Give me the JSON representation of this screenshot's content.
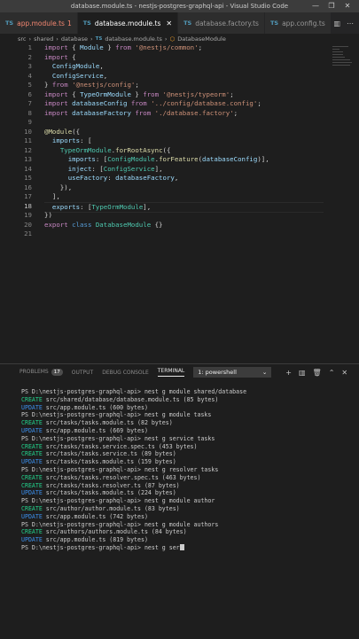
{
  "window": {
    "title": "database.module.ts - nestjs-postgres-graphql-api - Visual Studio Code",
    "controls": [
      "—",
      "❐",
      "✕"
    ]
  },
  "tabs": [
    {
      "label": "app.module.ts",
      "badge": "1",
      "state": "error"
    },
    {
      "label": "database.module.ts",
      "badge": "",
      "state": "active"
    },
    {
      "label": "database.factory.ts",
      "badge": "",
      "state": "normal"
    },
    {
      "label": "app.config.ts",
      "badge": "",
      "state": "normal"
    }
  ],
  "breadcrumb": {
    "parts": [
      "src",
      "shared",
      "database"
    ],
    "file": "database.module.ts",
    "symbol": "DatabaseModule"
  },
  "editor": {
    "current_line": 18,
    "lines": [
      {
        "n": "1",
        "t": [
          [
            "k",
            "import"
          ],
          [
            "p",
            " { "
          ],
          [
            "v",
            "Module"
          ],
          [
            "p",
            " } "
          ],
          [
            "k",
            "from"
          ],
          [
            "p",
            " "
          ],
          [
            "s",
            "'@nestjs/common'"
          ],
          [
            "p",
            ";"
          ]
        ]
      },
      {
        "n": "2",
        "t": [
          [
            "k",
            "import"
          ],
          [
            "p",
            " {"
          ]
        ]
      },
      {
        "n": "3",
        "t": [
          [
            "p",
            "  "
          ],
          [
            "v",
            "ConfigModule"
          ],
          [
            "p",
            ","
          ]
        ]
      },
      {
        "n": "4",
        "t": [
          [
            "p",
            "  "
          ],
          [
            "v",
            "ConfigService"
          ],
          [
            "p",
            ","
          ]
        ]
      },
      {
        "n": "5",
        "t": [
          [
            "p",
            "} "
          ],
          [
            "k",
            "from"
          ],
          [
            "p",
            " "
          ],
          [
            "s",
            "'@nestjs/config'"
          ],
          [
            "p",
            ";"
          ]
        ]
      },
      {
        "n": "6",
        "t": [
          [
            "k",
            "import"
          ],
          [
            "p",
            " { "
          ],
          [
            "v",
            "TypeOrmModule"
          ],
          [
            "p",
            " } "
          ],
          [
            "k",
            "from"
          ],
          [
            "p",
            " "
          ],
          [
            "s",
            "'@nestjs/typeorm'"
          ],
          [
            "p",
            ";"
          ]
        ]
      },
      {
        "n": "7",
        "t": [
          [
            "k",
            "import"
          ],
          [
            "p",
            " "
          ],
          [
            "v",
            "databaseConfig"
          ],
          [
            "p",
            " "
          ],
          [
            "k",
            "from"
          ],
          [
            "p",
            " "
          ],
          [
            "s",
            "'../config/database.config'"
          ],
          [
            "p",
            ";"
          ]
        ]
      },
      {
        "n": "8",
        "t": [
          [
            "k",
            "import"
          ],
          [
            "p",
            " "
          ],
          [
            "v",
            "databaseFactory"
          ],
          [
            "p",
            " "
          ],
          [
            "k",
            "from"
          ],
          [
            "p",
            " "
          ],
          [
            "s",
            "'./database.factory'"
          ],
          [
            "p",
            ";"
          ]
        ]
      },
      {
        "n": "9",
        "t": []
      },
      {
        "n": "10",
        "t": [
          [
            "d",
            "@"
          ],
          [
            "f",
            "Module"
          ],
          [
            "p",
            "({"
          ]
        ]
      },
      {
        "n": "11",
        "t": [
          [
            "p",
            "  "
          ],
          [
            "v",
            "imports"
          ],
          [
            "p",
            ": ["
          ]
        ]
      },
      {
        "n": "12",
        "t": [
          [
            "p",
            "    "
          ],
          [
            "c",
            "TypeOrmModule"
          ],
          [
            "p",
            "."
          ],
          [
            "f",
            "forRootAsync"
          ],
          [
            "p",
            "({"
          ]
        ]
      },
      {
        "n": "13",
        "t": [
          [
            "p",
            "      "
          ],
          [
            "v",
            "imports"
          ],
          [
            "p",
            ": ["
          ],
          [
            "c",
            "ConfigModule"
          ],
          [
            "p",
            "."
          ],
          [
            "f",
            "forFeature"
          ],
          [
            "p",
            "("
          ],
          [
            "v",
            "databaseConfig"
          ],
          [
            "p",
            ")],"
          ]
        ]
      },
      {
        "n": "14",
        "t": [
          [
            "p",
            "      "
          ],
          [
            "v",
            "inject"
          ],
          [
            "p",
            ": ["
          ],
          [
            "c",
            "ConfigService"
          ],
          [
            "p",
            "],"
          ]
        ]
      },
      {
        "n": "15",
        "t": [
          [
            "p",
            "      "
          ],
          [
            "v",
            "useFactory"
          ],
          [
            "p",
            ": "
          ],
          [
            "v",
            "databaseFactory"
          ],
          [
            "p",
            ","
          ]
        ]
      },
      {
        "n": "16",
        "t": [
          [
            "p",
            "    }),"
          ]
        ]
      },
      {
        "n": "17",
        "t": [
          [
            "p",
            "  ],"
          ]
        ]
      },
      {
        "n": "18",
        "t": [
          [
            "p",
            "  "
          ],
          [
            "v",
            "exports"
          ],
          [
            "p",
            ": ["
          ],
          [
            "c",
            "TypeOrmModule"
          ],
          [
            "p",
            "],"
          ]
        ]
      },
      {
        "n": "19",
        "t": [
          [
            "p",
            "})"
          ]
        ]
      },
      {
        "n": "20",
        "t": [
          [
            "k",
            "export"
          ],
          [
            "p",
            " "
          ],
          [
            "kb",
            "class"
          ],
          [
            "p",
            " "
          ],
          [
            "c",
            "DatabaseModule"
          ],
          [
            "p",
            " {}"
          ]
        ]
      },
      {
        "n": "21",
        "t": []
      }
    ]
  },
  "panel": {
    "tabs": [
      {
        "label": "PROBLEMS",
        "badge": "17"
      },
      {
        "label": "OUTPUT",
        "badge": ""
      },
      {
        "label": "DEBUG CONSOLE",
        "badge": ""
      },
      {
        "label": "TERMINAL",
        "badge": ""
      }
    ],
    "active_tab": "TERMINAL",
    "terminal_select": "1: powershell",
    "actions": [
      "+",
      "▥",
      "🗑",
      "⌃",
      "✕"
    ]
  },
  "terminal": [
    {
      "type": "prompt",
      "text": "PS D:\\nestjs-postgres-graphql-api> nest g module shared/database"
    },
    {
      "type": "create",
      "label": "CREATE",
      "text": " src/shared/database/database.module.ts (85 bytes)"
    },
    {
      "type": "update",
      "label": "UPDATE",
      "text": " src/app.module.ts (600 bytes)"
    },
    {
      "type": "prompt",
      "text": "PS D:\\nestjs-postgres-graphql-api> nest g module tasks"
    },
    {
      "type": "create",
      "label": "CREATE",
      "text": " src/tasks/tasks.module.ts (82 bytes)"
    },
    {
      "type": "update",
      "label": "UPDATE",
      "text": " src/app.module.ts (669 bytes)"
    },
    {
      "type": "prompt",
      "text": "PS D:\\nestjs-postgres-graphql-api> nest g service tasks"
    },
    {
      "type": "create",
      "label": "CREATE",
      "text": " src/tasks/tasks.service.spec.ts (453 bytes)"
    },
    {
      "type": "create",
      "label": "CREATE",
      "text": " src/tasks/tasks.service.ts (89 bytes)"
    },
    {
      "type": "update",
      "label": "UPDATE",
      "text": " src/tasks/tasks.module.ts (159 bytes)"
    },
    {
      "type": "prompt",
      "text": "PS D:\\nestjs-postgres-graphql-api> nest g resolver tasks"
    },
    {
      "type": "create",
      "label": "CREATE",
      "text": " src/tasks/tasks.resolver.spec.ts (463 bytes)"
    },
    {
      "type": "create",
      "label": "CREATE",
      "text": " src/tasks/tasks.resolver.ts (87 bytes)"
    },
    {
      "type": "update",
      "label": "UPDATE",
      "text": " src/tasks/tasks.module.ts (224 bytes)"
    },
    {
      "type": "prompt",
      "text": "PS D:\\nestjs-postgres-graphql-api> nest g module author"
    },
    {
      "type": "create",
      "label": "CREATE",
      "text": " src/author/author.module.ts (83 bytes)"
    },
    {
      "type": "update",
      "label": "UPDATE",
      "text": " src/app.module.ts (742 bytes)"
    },
    {
      "type": "prompt",
      "text": "PS D:\\nestjs-postgres-graphql-api> nest g module authors"
    },
    {
      "type": "create",
      "label": "CREATE",
      "text": " src/authors/authors.module.ts (84 bytes)"
    },
    {
      "type": "update",
      "label": "UPDATE",
      "text": " src/app.module.ts (819 bytes)"
    },
    {
      "type": "input",
      "text": "PS D:\\nestjs-postgres-graphql-api> nest g ser"
    }
  ]
}
